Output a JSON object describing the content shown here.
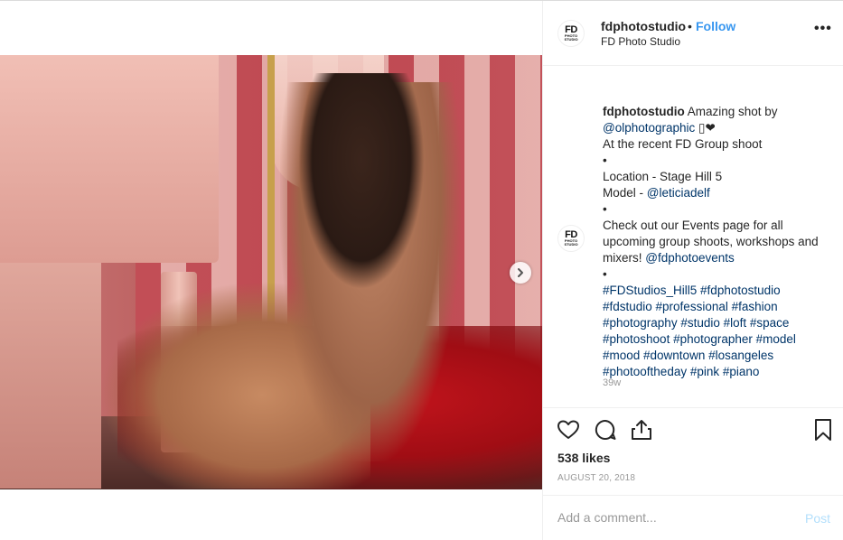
{
  "header": {
    "username": "fdphotostudio",
    "separator": "•",
    "follow_label": "Follow",
    "full_name": "FD Photo Studio",
    "more_label": "•••"
  },
  "logo": {
    "line1": "FD",
    "line2": "PHOTO",
    "line3": "STUDIO"
  },
  "caption": {
    "username": "fdphotostudio",
    "segments": [
      {
        "text": " Amazing shot by\n",
        "link": false
      },
      {
        "text": "@olphotographic",
        "link": true
      },
      {
        "text": " ▯❤\nAt the recent FD Group shoot\n•\nLocation - Stage Hill 5\nModel - ",
        "link": false
      },
      {
        "text": "@leticiadelf",
        "link": true
      },
      {
        "text": "\n•\nCheck out our Events page for all upcoming group shoots, workshops and mixers! ",
        "link": false
      },
      {
        "text": "@fdphotoevents",
        "link": true
      },
      {
        "text": "\n•\n",
        "link": false
      },
      {
        "text": "#FDStudios_Hill5 #fdphotostudio #fdstudio #professional #fashion #photography #studio #loft #space #photoshoot #photographer #model #mood #downtown #losangeles #photooftheday #pink #piano",
        "link": true
      }
    ]
  },
  "time_ago": "39w",
  "likes": "538 likes",
  "date": "AUGUST 20, 2018",
  "comment": {
    "placeholder": "Add a comment...",
    "value": "",
    "post_label": "Post"
  },
  "icons": {
    "like": "heart-icon",
    "comment": "comment-bubble-icon",
    "share": "share-icon",
    "save": "bookmark-icon",
    "next": "chevron-right-icon",
    "more": "more-options-icon"
  },
  "colors": {
    "link": "#003569",
    "follow": "#3897f0",
    "muted": "#999999",
    "post_disabled": "#b2dffc",
    "border": "#efefef"
  }
}
